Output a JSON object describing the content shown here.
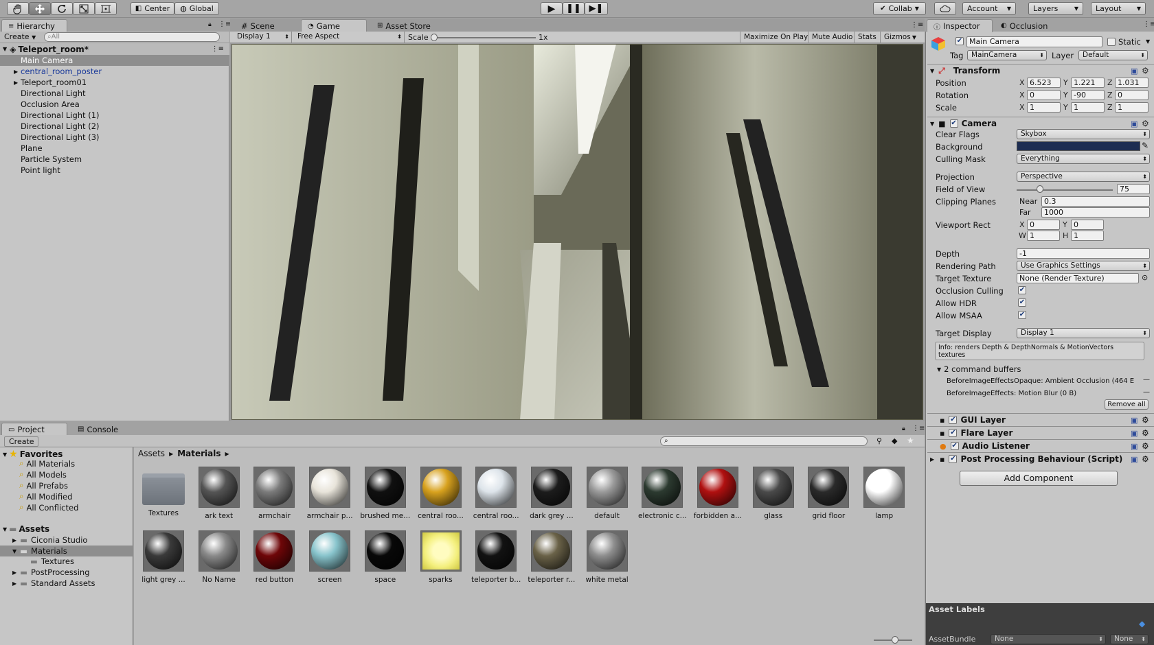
{
  "toolbar": {
    "center": "Center",
    "global": "Global",
    "collab": "Collab",
    "account": "Account",
    "layers": "Layers",
    "layout": "Layout"
  },
  "hierarchy": {
    "tab": "Hierarchy",
    "create": "Create",
    "search_placeholder": "All",
    "scene": "Teleport_room*",
    "items": [
      {
        "label": "Main Camera"
      },
      {
        "label": "central_room_poster"
      },
      {
        "label": "Teleport_room01"
      },
      {
        "label": "Directional Light"
      },
      {
        "label": "Occlusion Area"
      },
      {
        "label": "Directional Light (1)"
      },
      {
        "label": "Directional Light (2)"
      },
      {
        "label": "Directional Light (3)"
      },
      {
        "label": "Plane"
      },
      {
        "label": "Particle System"
      },
      {
        "label": "Point light"
      }
    ]
  },
  "viewtabs": {
    "scene": "Scene",
    "game": "Game",
    "asset_store": "Asset Store"
  },
  "gamebar": {
    "display": "Display 1",
    "aspect": "Free Aspect",
    "scale_label": "Scale",
    "scale_value": "1x",
    "maximize": "Maximize On Play",
    "mute": "Mute Audio",
    "stats": "Stats",
    "gizmos": "Gizmos"
  },
  "project": {
    "tab": "Project",
    "console_tab": "Console",
    "create": "Create",
    "favorites": "Favorites",
    "fav_items": [
      "All Materials",
      "All Models",
      "All Prefabs",
      "All Modified",
      "All Conflicted"
    ],
    "assets": "Assets",
    "tree": [
      "Ciconia Studio",
      "Materials",
      "Textures",
      "PostProcessing",
      "Standard Assets"
    ],
    "crumb_root": "Assets",
    "crumb_current": "Materials",
    "grid": [
      {
        "label": "Textures",
        "kind": "folder"
      },
      {
        "label": "ark text",
        "color": "#555"
      },
      {
        "label": "armchair",
        "color": "#7b7b7b"
      },
      {
        "label": "armchair p...",
        "color": "#e8e4da"
      },
      {
        "label": "brushed me...",
        "color": "#101010"
      },
      {
        "label": "central roo...",
        "color": "#d8a21e"
      },
      {
        "label": "central roo...",
        "color": "#dde4ea"
      },
      {
        "label": "dark grey ...",
        "color": "#1c1c1c"
      },
      {
        "label": "default",
        "color": "#9a9a9a"
      },
      {
        "label": "electronic c...",
        "color": "#2c3a30"
      },
      {
        "label": "forbidden a...",
        "color": "#b01010"
      },
      {
        "label": "glass",
        "color": "#4a4a4a"
      },
      {
        "label": "grid floor",
        "color": "#2a2a2a"
      },
      {
        "label": "lamp",
        "color": "#ffffff"
      },
      {
        "label": "light grey ...",
        "color": "#3a3a3a"
      },
      {
        "label": "No Name",
        "color": "#8a8a8a"
      },
      {
        "label": "red button",
        "color": "#6e0608"
      },
      {
        "label": "screen",
        "color": "#88c4cc"
      },
      {
        "label": "space",
        "color": "#080808"
      },
      {
        "label": "sparks",
        "color": "#f4f080",
        "kind": "square"
      },
      {
        "label": "teleporter b...",
        "color": "#121212"
      },
      {
        "label": "teleporter r...",
        "color": "#6a6248"
      },
      {
        "label": "white metal",
        "color": "#8e8e8e"
      }
    ]
  },
  "inspector": {
    "tab": "Inspector",
    "occlusion_tab": "Occlusion",
    "object_name": "Main Camera",
    "static": "Static",
    "tag_label": "Tag",
    "tag": "MainCamera",
    "layer_label": "Layer",
    "layer": "Default",
    "transform": {
      "title": "Transform",
      "position_label": "Position",
      "rotation_label": "Rotation",
      "scale_label": "Scale",
      "position": [
        "6.523",
        "1.221",
        "1.031"
      ],
      "rotation": [
        "0",
        "-90",
        "0"
      ],
      "scale": [
        "1",
        "1",
        "1"
      ]
    },
    "camera": {
      "title": "Camera",
      "clear_flags_label": "Clear Flags",
      "clear_flags": "Skybox",
      "background_label": "Background",
      "background_color": "#1d2d52",
      "culling_label": "Culling Mask",
      "culling": "Everything",
      "projection_label": "Projection",
      "projection": "Perspective",
      "fov_label": "Field of View",
      "fov": "75",
      "fov_fraction": 0.18,
      "clipping_label": "Clipping Planes",
      "near_label": "Near",
      "near": "0.3",
      "far_label": "Far",
      "far": "1000",
      "viewport_label": "Viewport Rect",
      "vp_x": "0",
      "vp_y": "0",
      "vp_w": "1",
      "vp_h": "1",
      "depth_label": "Depth",
      "depth": "-1",
      "render_path_label": "Rendering Path",
      "render_path": "Use Graphics Settings",
      "target_tex_label": "Target Texture",
      "target_tex": "None (Render Texture)",
      "occ_label": "Occlusion Culling",
      "hdr_label": "Allow HDR",
      "msaa_label": "Allow MSAA",
      "target_display_label": "Target Display",
      "target_display": "Display 1",
      "info": "Info: renders Depth & DepthNormals & MotionVectors textures",
      "cmd_buffers": "2 command buffers",
      "cmd1": "BeforeImageEffectsOpaque: Ambient Occlusion (464 E",
      "cmd2": "BeforeImageEffects: Motion Blur (0 B)",
      "remove_all": "Remove all"
    },
    "gui_layer": "GUI Layer",
    "flare_layer": "Flare Layer",
    "audio_listener": "Audio Listener",
    "post_processing": "Post Processing Behaviour (Script)",
    "add_component": "Add Component",
    "asset_labels": "Asset Labels",
    "assetbundle_label": "AssetBundle",
    "assetbundle": "None",
    "variant": "None"
  }
}
